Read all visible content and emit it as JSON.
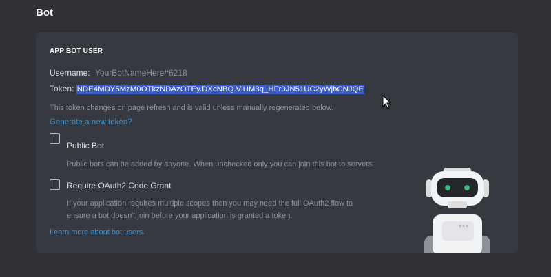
{
  "page": {
    "title": "Bot"
  },
  "app_bot_user": {
    "section_label": "APP BOT USER",
    "username_label": "Username:",
    "username_value": "YourBotNameHere#6218",
    "token_label": "Token:",
    "token_value": "NDE4MDY5MzM0OTkzNDAzOTEy.DXcNBQ.VlUM3q_HFr0JN51UC2yWjbCNJQE",
    "token_hint": "This token changes on page refresh and is valid unless manually regenerated below.",
    "generate_link": "Generate a new token?",
    "public_bot": {
      "label": "Public Bot",
      "checked": false,
      "description": "Public bots can be added by anyone. When unchecked only you can join this bot to servers."
    },
    "oauth_grant": {
      "label": "Require OAuth2 Code Grant",
      "checked": false,
      "description_line1": "If your application requires multiple scopes then you may need the full OAuth2 flow to",
      "description_line2": "ensure a bot doesn't join before your application is granted a token."
    },
    "learn_more_link": "Learn more about bot users."
  },
  "colors": {
    "background": "#2f3136",
    "card": "#36393f",
    "link": "#3a92d4",
    "selection": "#3b5dc9",
    "robot_eyes": "#43b581"
  },
  "icons": [
    "robot-illustration",
    "mouse-cursor-icon"
  ]
}
